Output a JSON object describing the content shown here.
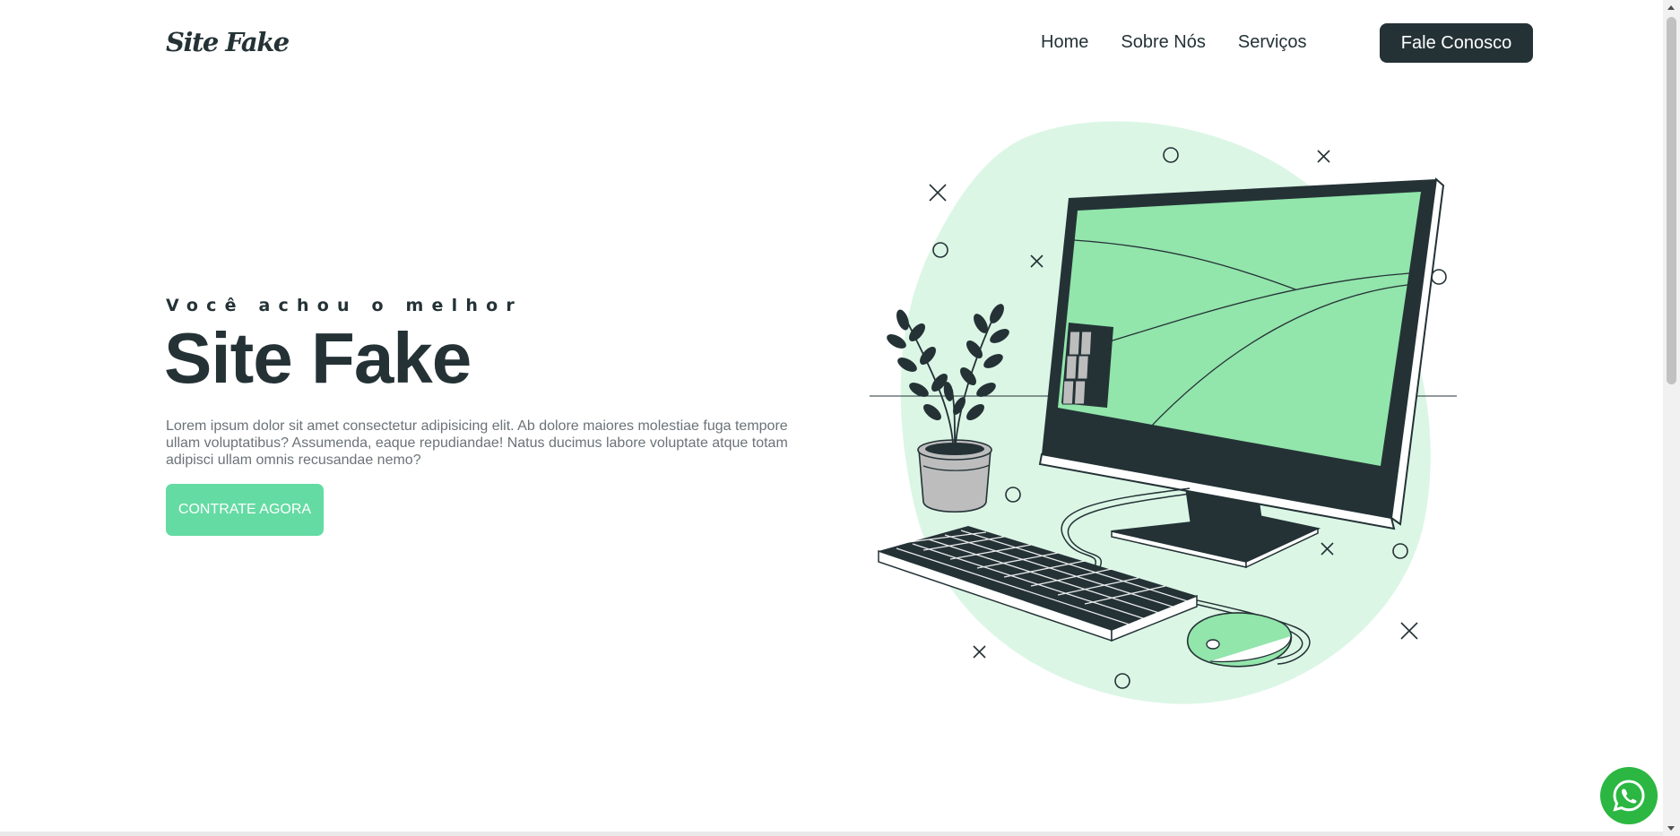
{
  "header": {
    "logo": "Site Fake",
    "nav": [
      {
        "label": "Home"
      },
      {
        "label": "Sobre Nós"
      },
      {
        "label": "Serviços"
      }
    ],
    "cta_label": "Fale Conosco"
  },
  "hero": {
    "eyebrow": "Você achou o melhor",
    "title": "Site Fake",
    "description": "Lorem ipsum dolor sit amet consectetur adipisicing elit. Ab dolore maiores molestiae fuga tempore ullam voluptatibus? Assumenda, eaque repudiandae! Natus ducimus labore voluptate atque totam adipisci ullam omnis recusandae nemo?",
    "button_label": "CONTRATE AGORA"
  },
  "illustration": {
    "icon": "computer-desk-illustration"
  },
  "floating": {
    "icon": "whatsapp-icon"
  },
  "colors": {
    "dark": "#243236",
    "accent": "#64dba3",
    "accent_light": "#dcf6e6",
    "screen": "#92e5ab",
    "whatsapp": "#2bb741",
    "text_muted": "#6b7378"
  }
}
